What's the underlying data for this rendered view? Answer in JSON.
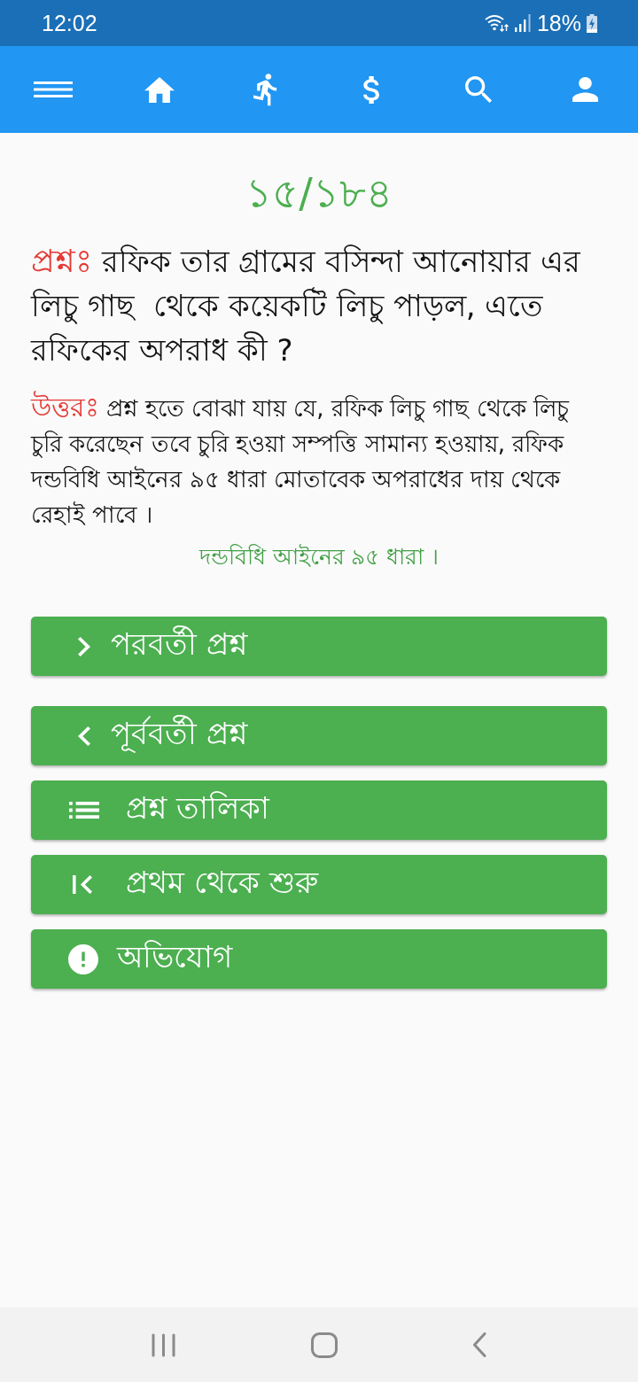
{
  "status_bar": {
    "time": "12:02",
    "battery": "18%"
  },
  "progress": "১৫/১৮৪",
  "question": {
    "label": "প্রশ্নঃ",
    "text": "রফিক তার গ্রামের বসিন্দা আনোয়ার এর লিচু গাছ  থেকে কয়েকটি লিচু পাড়ল, এতে রফিকের অপরাধ কী ?"
  },
  "answer": {
    "label": "উত্তরঃ",
    "text": "প্রশ্ন হতে বোঝা যায় যে, রফিক লিচু গাছ থেকে লিচু চুরি করেছেন তবে চুরি হওয়া সম্পত্তি সামান্য হওয়ায়, রফিক দন্ডবিধি আইনের ৯৫ ধারা মোতাবেক অপরাধের দায় থেকে রেহাই পাবে ।"
  },
  "reference": "দন্ডবিধি আইনের ৯৫ ধারা ।",
  "next_button": {
    "kind": "next",
    "label": "পরবর্তী প্রশ্ন"
  },
  "buttons": [
    {
      "kind": "previous",
      "label": "পূর্ববর্তী প্রশ্ন"
    },
    {
      "kind": "list",
      "label": "প্রশ্ন তালিকা"
    },
    {
      "kind": "first",
      "label": "প্রথম থেকে শুরু"
    },
    {
      "kind": "report",
      "label": "অভিযোগ"
    }
  ]
}
